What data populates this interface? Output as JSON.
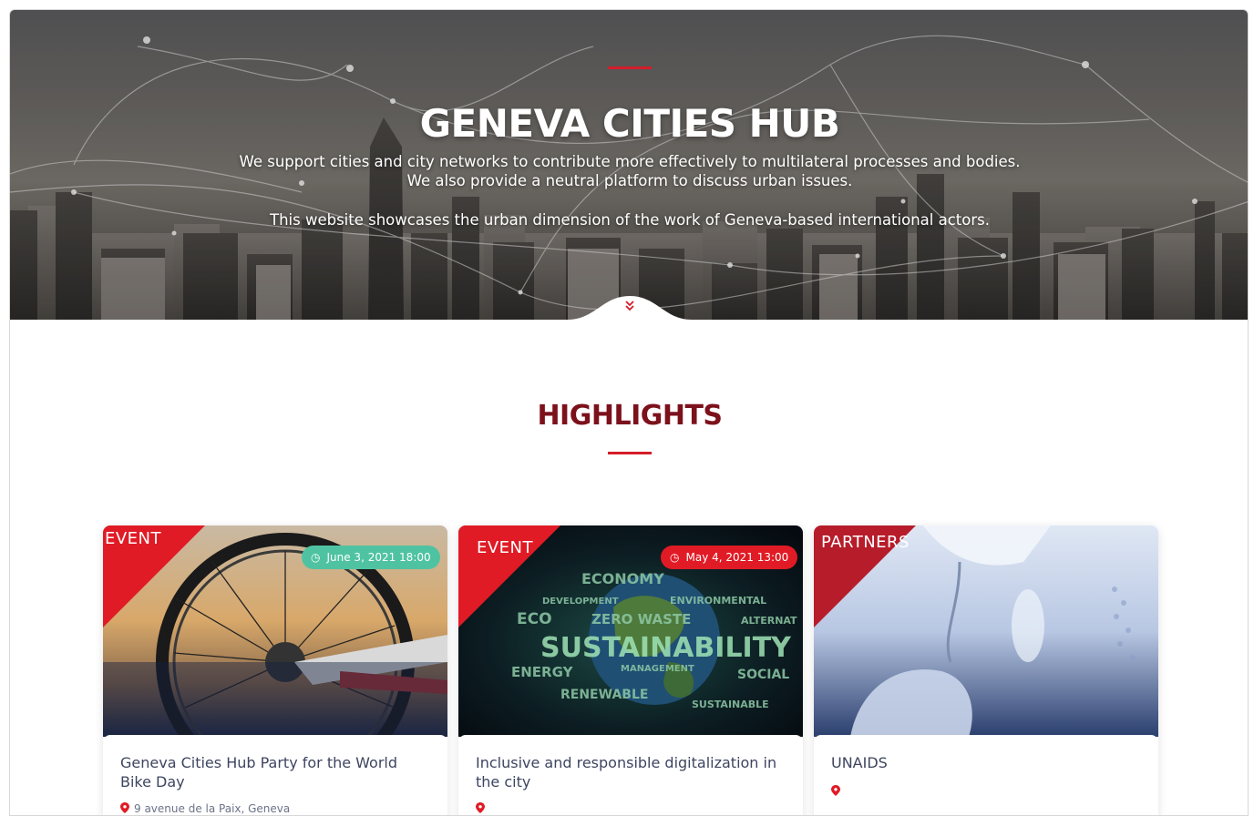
{
  "hero": {
    "title": "GENEVA CITIES HUB",
    "line1": "We support cities and city networks to contribute more effectively to multilateral processes and bodies.",
    "line2": "We also provide a neutral platform to discuss urban issues.",
    "line3": "This website showcases the urban dimension of the work of Geneva-based international actors.",
    "scroll_icon": "double-chevron-down-icon"
  },
  "highlights": {
    "title": "HIGHLIGHTS",
    "cards": [
      {
        "tag": "EVENT",
        "date": "June 3, 2021 18:00",
        "date_color": "#4fc3a1",
        "title": "Geneva Cities Hub Party for the World Bike Day",
        "location": "9 avenue de la Paix, Geneva"
      },
      {
        "tag": "EVENT",
        "date": "May 4, 2021 13:00",
        "date_color": "#e01b25",
        "title": "Inclusive and responsible digitalization in the city",
        "location": ""
      },
      {
        "tag": "PARTNERS",
        "date": "",
        "title": "UNAIDS",
        "location": ""
      }
    ]
  },
  "colors": {
    "accent": "#d51d2a",
    "heading": "#7c111c",
    "card_text": "#3d4560"
  }
}
